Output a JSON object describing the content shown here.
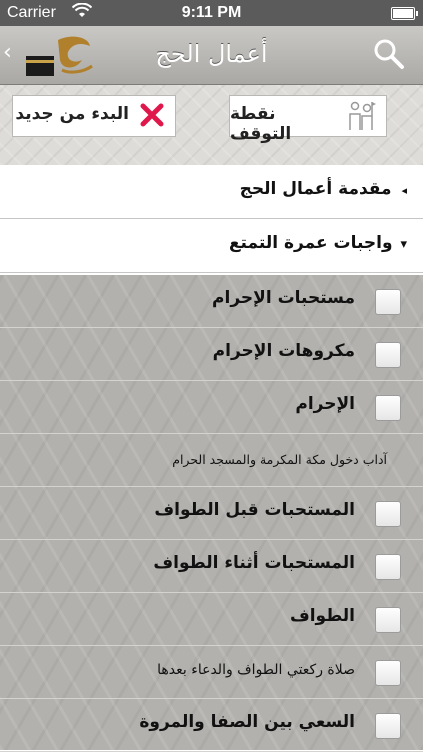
{
  "status_bar": {
    "carrier": "Carrier",
    "time": "9:11 PM"
  },
  "nav": {
    "title": "أعمال الحج",
    "back_chevron": "‹"
  },
  "toolbar": {
    "restart_label": "البدء من جديد",
    "stop_point_label": "نقطة التوقف"
  },
  "sections": [
    {
      "label": "مقدمة أعمال الحج",
      "indicator": "◂"
    },
    {
      "label": "واجبات عمرة التمتع",
      "indicator": "▾"
    }
  ],
  "items": [
    {
      "text": "مستحبات الإحرام",
      "has_checkbox": true
    },
    {
      "text": "مكروهات الإحرام",
      "has_checkbox": true
    },
    {
      "text": "الإحرام",
      "has_checkbox": true
    },
    {
      "text": "آداب دخول مكة المكرمة والمسجد الحرام",
      "has_checkbox": false
    },
    {
      "text": "المستحبات قبل الطواف",
      "has_checkbox": true
    },
    {
      "text": "المستحبات أثناء الطواف",
      "has_checkbox": true
    },
    {
      "text": "الطواف",
      "has_checkbox": true
    },
    {
      "text": "صلاة ركعتي الطواف والدعاء بعدها",
      "has_checkbox": true
    },
    {
      "text": "السعي بين الصفا والمروة",
      "has_checkbox": true
    }
  ],
  "colors": {
    "status_bar": "#5b5b5b",
    "restart_icon": "#e0174a"
  }
}
